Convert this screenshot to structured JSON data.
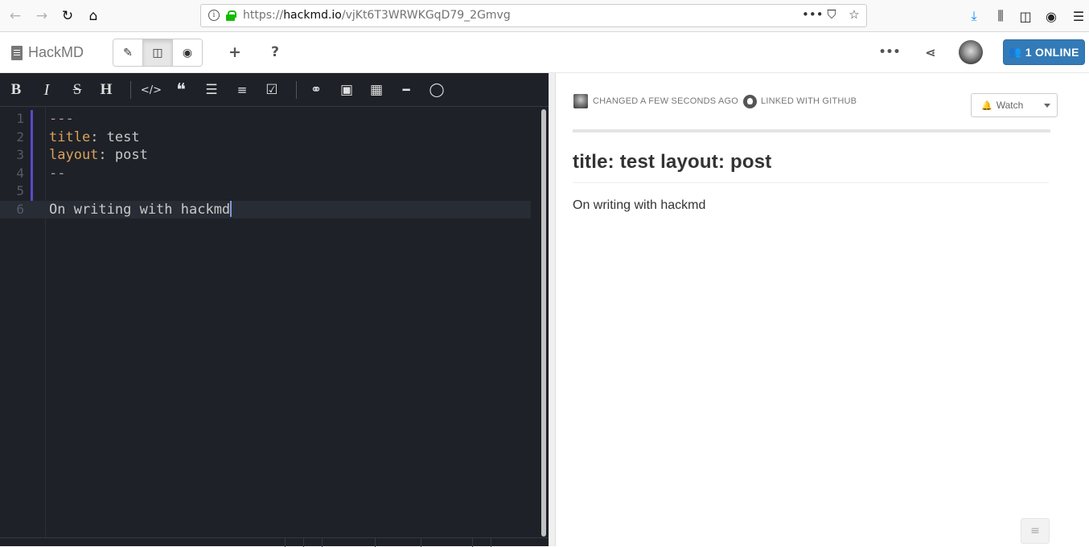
{
  "browser": {
    "url_prefix": "https://",
    "url_host": "hackmd.io",
    "url_path": "/vjKt6T3WRWKGqD79_2Gmvg"
  },
  "navbar": {
    "brand": "HackMD",
    "online_label": "1 ONLINE"
  },
  "toolbar": {
    "bold": "B",
    "italic": "I",
    "strike": "S",
    "heading": "H"
  },
  "editor": {
    "lines": [
      {
        "n": "1",
        "text": "---"
      },
      {
        "n": "2",
        "key": "title",
        "sep": ": ",
        "value": "test"
      },
      {
        "n": "3",
        "key": "layout",
        "sep": ": ",
        "value": "post"
      },
      {
        "n": "4",
        "text": "--"
      },
      {
        "n": "5",
        "text": ""
      },
      {
        "n": "6",
        "text": "On writing with hackmd"
      }
    ]
  },
  "preview": {
    "changed": "CHANGED A FEW SECONDS AGO",
    "linked": "LINKED WITH GITHUB",
    "watch_label": "Watch",
    "title": "title: test layout: post",
    "body": "On writing with hackmd"
  }
}
